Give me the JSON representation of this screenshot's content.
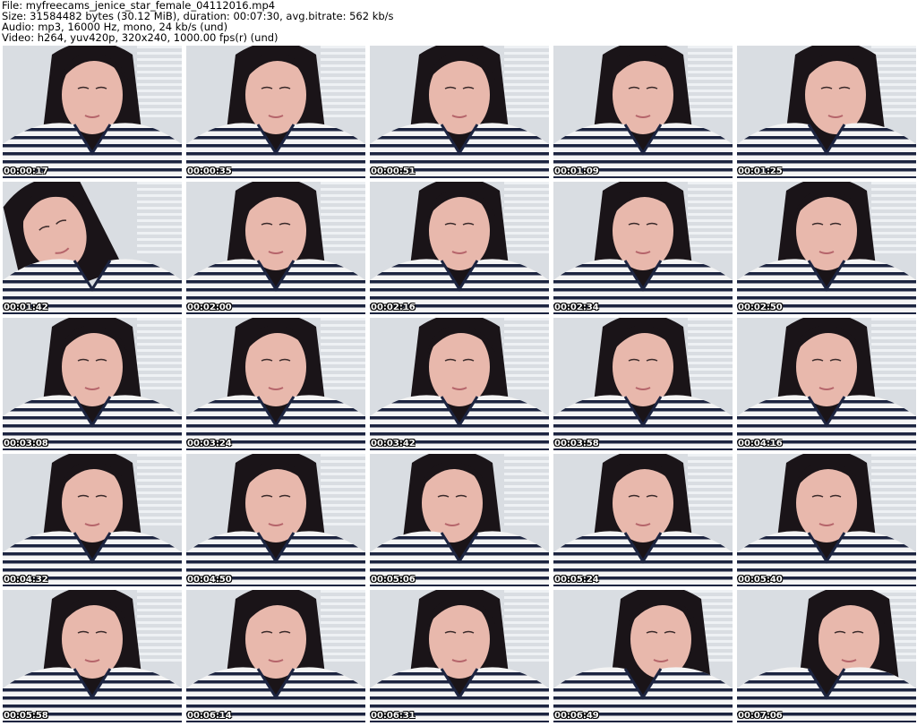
{
  "header": {
    "file_line": "File: myfreecams_jenice_star_female_04112016.mp4",
    "size_line": "Size: 31584482 bytes (30.12 MiB), duration: 00:07:30, avg.bitrate: 562 kb/s",
    "audio_line": "Audio: mp3, 16000 Hz, mono, 24 kb/s (und)",
    "video_line": "Video: h264, yuv420p, 320x240, 1000.00 fps(r) (und)"
  },
  "thumbnails": [
    {
      "timestamp": "00:00:17"
    },
    {
      "timestamp": "00:00:35"
    },
    {
      "timestamp": "00:00:51"
    },
    {
      "timestamp": "00:01:09"
    },
    {
      "timestamp": "00:01:25"
    },
    {
      "timestamp": "00:01:42"
    },
    {
      "timestamp": "00:02:00"
    },
    {
      "timestamp": "00:02:16"
    },
    {
      "timestamp": "00:02:34"
    },
    {
      "timestamp": "00:02:50"
    },
    {
      "timestamp": "00:03:08"
    },
    {
      "timestamp": "00:03:24"
    },
    {
      "timestamp": "00:03:42"
    },
    {
      "timestamp": "00:03:58"
    },
    {
      "timestamp": "00:04:16"
    },
    {
      "timestamp": "00:04:32"
    },
    {
      "timestamp": "00:04:50"
    },
    {
      "timestamp": "00:05:06"
    },
    {
      "timestamp": "00:05:24"
    },
    {
      "timestamp": "00:05:40"
    },
    {
      "timestamp": "00:05:58"
    },
    {
      "timestamp": "00:06:14"
    },
    {
      "timestamp": "00:06:31"
    },
    {
      "timestamp": "00:06:49"
    },
    {
      "timestamp": "00:07:06"
    }
  ],
  "colors": {
    "background": "#ffffff",
    "wall": "#d9dde2",
    "blinds": "#eef1f4",
    "hair": "#1a1418",
    "skin": "#e8b8ac",
    "shirt": "#f4f4f4",
    "stripe": "#1c2440",
    "timestamp_text": "#ffffff"
  }
}
